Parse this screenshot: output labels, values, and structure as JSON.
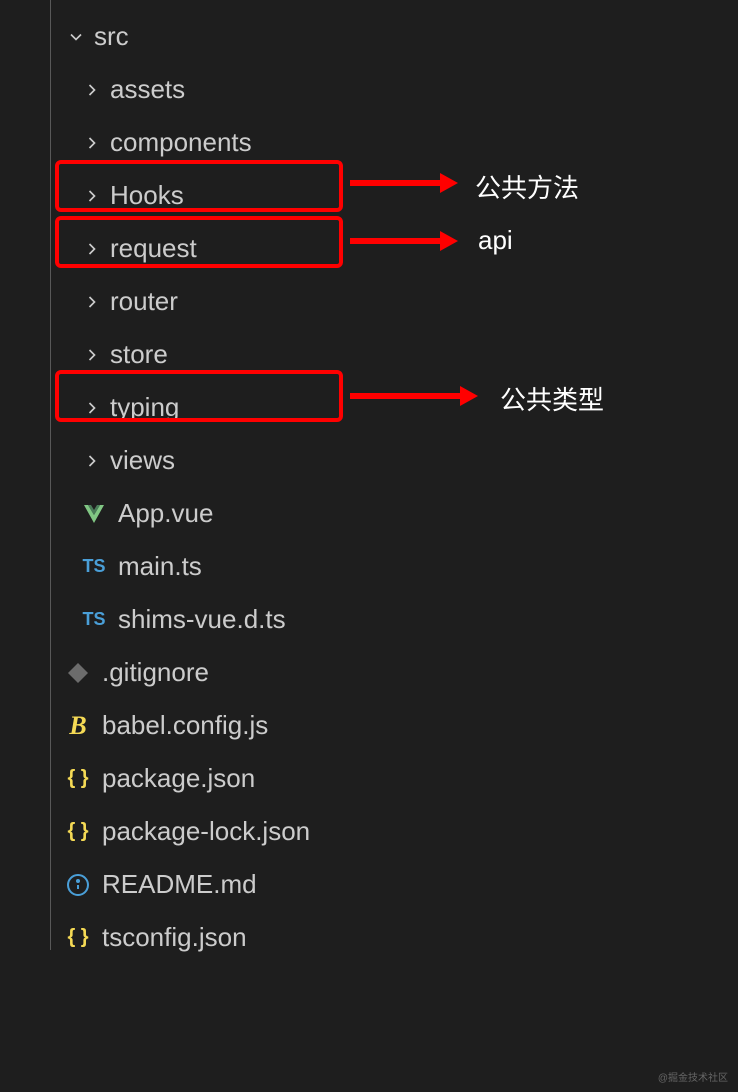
{
  "tree": {
    "root": "src",
    "folders": {
      "assets": "assets",
      "components": "components",
      "hooks": "Hooks",
      "request": "request",
      "router": "router",
      "store": "store",
      "typing": "typing",
      "views": "views"
    },
    "files": {
      "appvue": "App.vue",
      "maints": "main.ts",
      "shims": "shims-vue.d.ts",
      "gitignore": ".gitignore",
      "babel": "babel.config.js",
      "package": "package.json",
      "packagelock": "package-lock.json",
      "readme": "README.md",
      "tsconfig": "tsconfig.json"
    }
  },
  "annotations": {
    "hooks": "公共方法",
    "request": "api",
    "typing": "公共类型"
  },
  "icons": {
    "ts": "TS",
    "braces": "{ }",
    "babel": "B"
  },
  "watermark": "@掘金技术社区"
}
